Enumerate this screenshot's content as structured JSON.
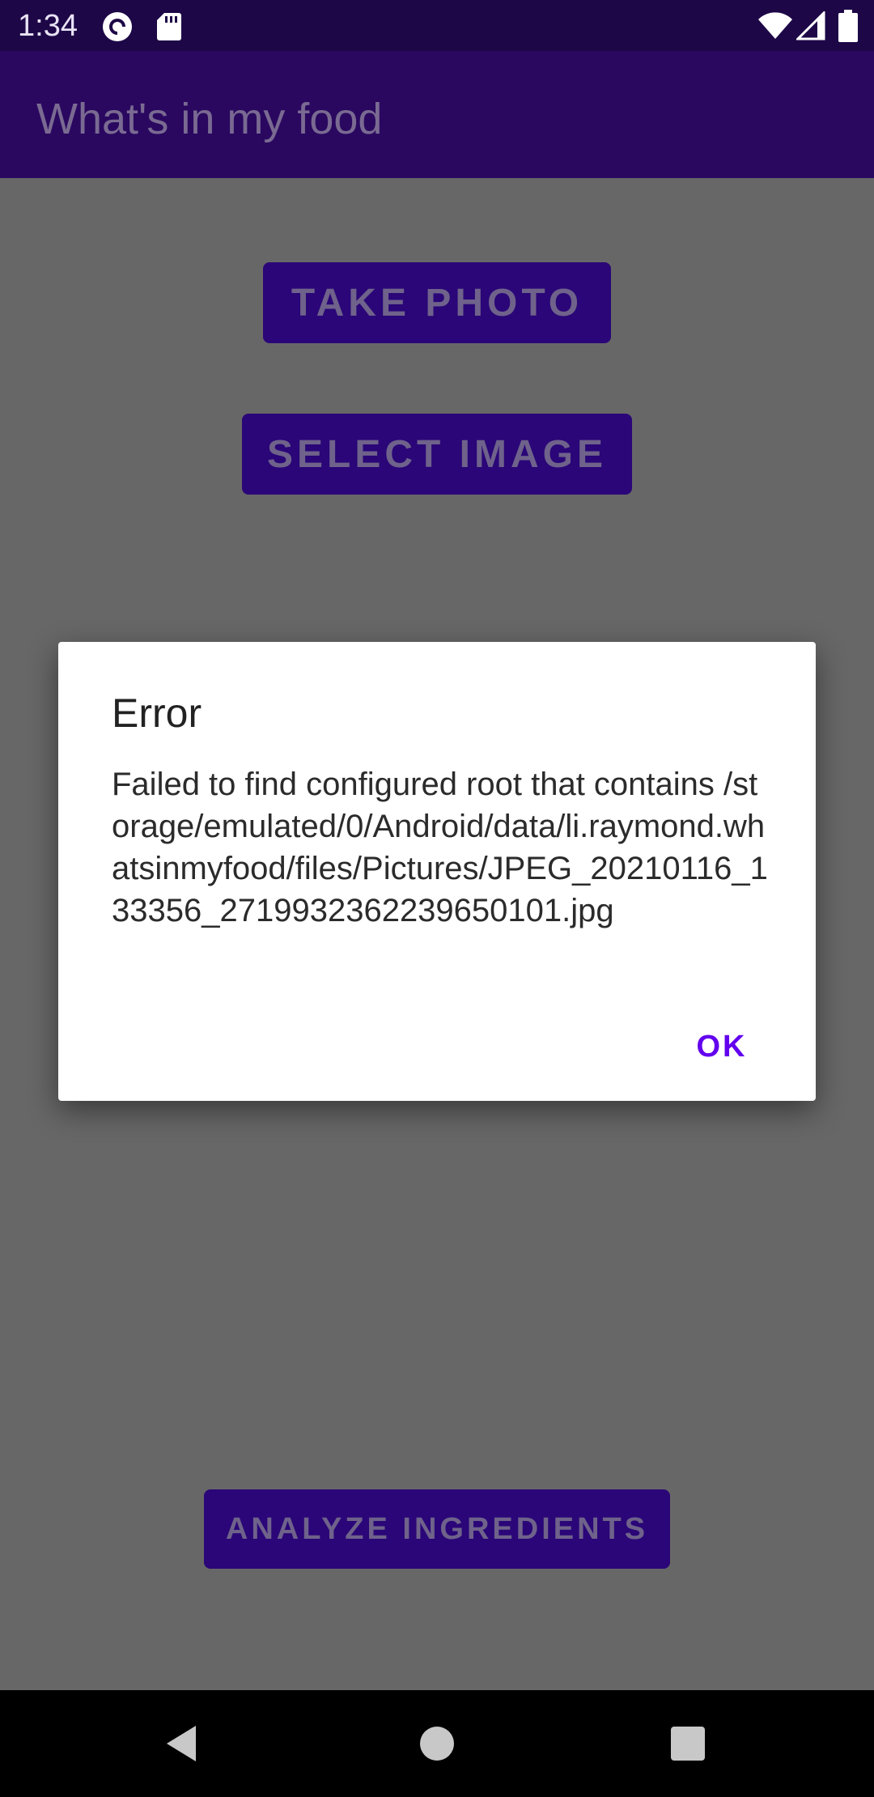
{
  "status_bar": {
    "time": "1:34",
    "icons": [
      "pocket-casts-icon",
      "sd-card-icon",
      "wifi-icon",
      "signal-icon",
      "battery-icon"
    ]
  },
  "app_bar": {
    "title": "What's in my food"
  },
  "main": {
    "take_photo_label": "TAKE PHOTO",
    "select_image_label": "SELECT IMAGE",
    "analyze_label": "ANALYZE INGREDIENTS"
  },
  "dialog": {
    "title": "Error",
    "message": "Failed to find configured root that contains /storage/emulated/0/Android/data/li.raymond.whatsinmyfood/files/Pictures/JPEG_20210116_133356_2719932362239650101.jpg",
    "ok_label": "OK"
  },
  "nav_bar": {
    "icons": [
      "back-icon",
      "home-icon",
      "recents-icon"
    ]
  },
  "colors": {
    "primary": "#2a0678",
    "scrim": "#676767",
    "accent": "#6200ee"
  }
}
